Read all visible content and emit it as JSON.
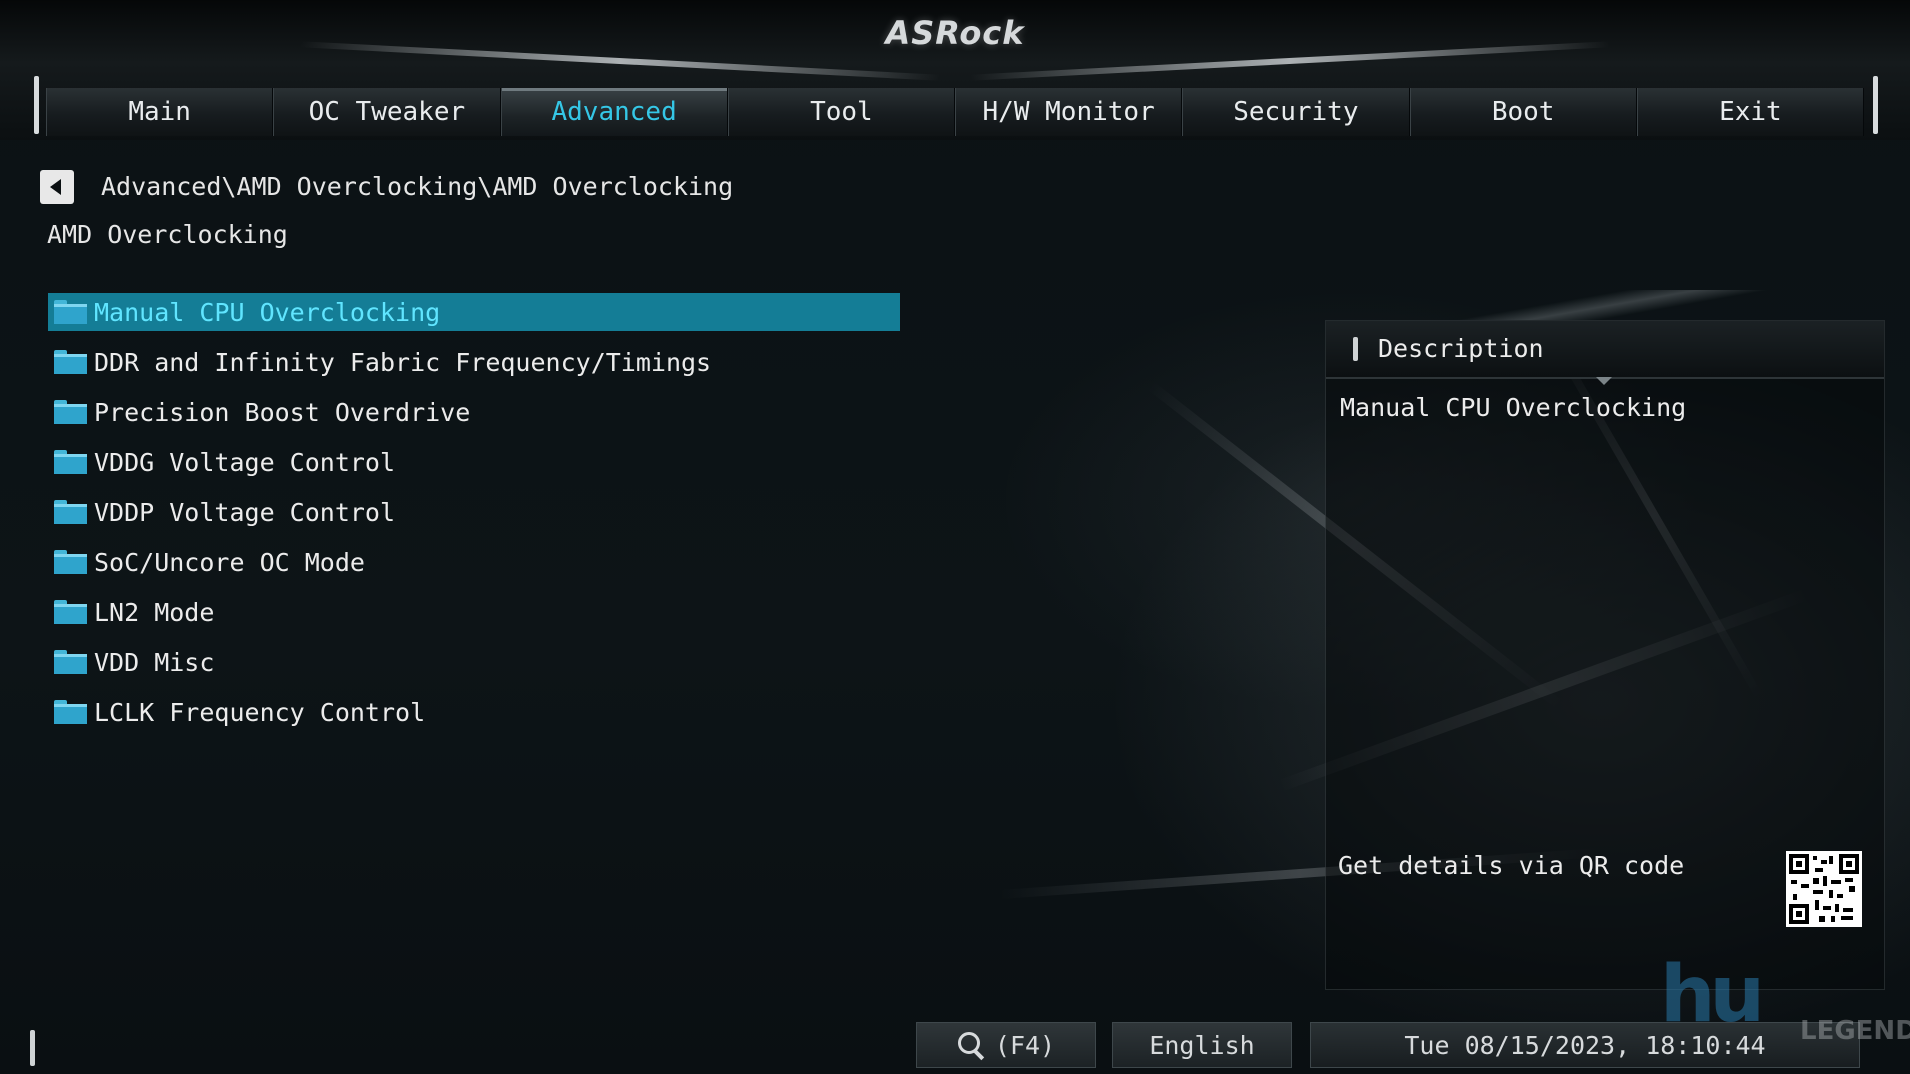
{
  "header": {
    "logo_text": "ASRock",
    "tabs": [
      {
        "label": "Main",
        "active": false
      },
      {
        "label": "OC Tweaker",
        "active": false
      },
      {
        "label": "Advanced",
        "active": true
      },
      {
        "label": "Tool",
        "active": false
      },
      {
        "label": "H/W Monitor",
        "active": false
      },
      {
        "label": "Security",
        "active": false
      },
      {
        "label": "Boot",
        "active": false
      },
      {
        "label": "Exit",
        "active": false
      }
    ]
  },
  "breadcrumb": {
    "path": "Advanced\\AMD Overclocking\\AMD Overclocking"
  },
  "page_title": "AMD Overclocking",
  "menu": {
    "items": [
      {
        "label": "Manual CPU Overclocking",
        "selected": true
      },
      {
        "label": "DDR and Infinity Fabric Frequency/Timings",
        "selected": false
      },
      {
        "label": "Precision Boost Overdrive",
        "selected": false
      },
      {
        "label": "VDDG Voltage Control",
        "selected": false
      },
      {
        "label": "VDDP Voltage Control",
        "selected": false
      },
      {
        "label": "SoC/Uncore OC Mode",
        "selected": false
      },
      {
        "label": "LN2 Mode",
        "selected": false
      },
      {
        "label": "VDD Misc",
        "selected": false
      },
      {
        "label": "LCLK Frequency Control",
        "selected": false
      }
    ]
  },
  "description": {
    "title": "Description",
    "text": "Manual CPU Overclocking",
    "qr_text": "Get details via QR code"
  },
  "footer": {
    "search_label": "(F4)",
    "language": "English",
    "datetime": "Tue 08/15/2023, 18:10:44"
  },
  "watermark": {
    "big": "hu",
    "small": "LEGEND"
  },
  "colors": {
    "accent": "#35c7e6",
    "selection_bg": "#147d96",
    "selection_text": "#60e5ff",
    "folder_icon": "#2fa4cc"
  }
}
